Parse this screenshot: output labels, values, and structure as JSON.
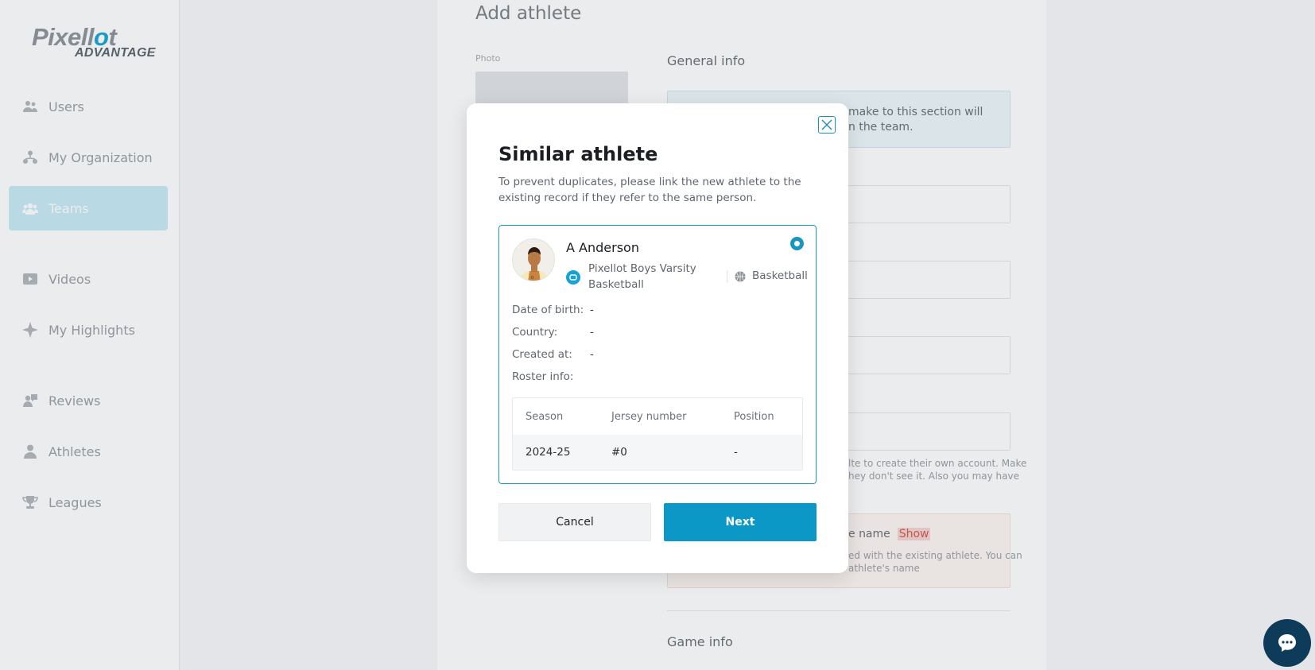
{
  "brand": {
    "logo_main_1": "Pixell",
    "logo_main_accent": "o",
    "logo_main_2": "t",
    "logo_sub": "ADVANTAGE"
  },
  "sidebar": {
    "items": [
      {
        "label": "Users",
        "icon": "users-icon"
      },
      {
        "label": "My Organization",
        "icon": "organization-icon"
      },
      {
        "label": "Teams",
        "icon": "teams-icon",
        "active": true
      },
      {
        "label": "Videos",
        "icon": "video-icon"
      },
      {
        "label": "My Highlights",
        "icon": "sparkle-icon"
      },
      {
        "label": "Reviews",
        "icon": "reviews-icon"
      },
      {
        "label": "Athletes",
        "icon": "athlete-icon"
      },
      {
        "label": "Leagues",
        "icon": "trophy-icon"
      }
    ]
  },
  "page": {
    "title": "Add athlete",
    "photo_label": "Photo",
    "general_info_title": "General info",
    "info_text_line1": "make to this section will",
    "info_text_line2": "n the team.",
    "invite_hint_line1": "lte to create their own account. Make",
    "invite_hint_line2": "hey don't see it. Also you may have",
    "same_name_label": "e name",
    "show_link": "Show",
    "warn_line1": "ed with the existing athlete. You can",
    "warn_line2": "athlete's name",
    "game_info_title": "Game info"
  },
  "modal": {
    "title": "Similar athlete",
    "description": "To prevent duplicates, please link the new athlete to the existing record if they refer to the same person.",
    "athlete": {
      "name": "A Anderson",
      "team": "Pixellot Boys Varsity Basketball",
      "sport": "Basketball",
      "fields": [
        {
          "label": "Date of birth:",
          "value": "-"
        },
        {
          "label": "Country:",
          "value": "-"
        },
        {
          "label": "Created at:",
          "value": "-"
        },
        {
          "label": "Roster info:",
          "value": ""
        }
      ],
      "roster": {
        "headers": [
          "Season",
          "Jersey number",
          "Position"
        ],
        "rows": [
          [
            "2024-25",
            "#0",
            "-"
          ]
        ]
      }
    },
    "cancel_label": "Cancel",
    "next_label": "Next"
  },
  "colors": {
    "accent": "#0b98c7",
    "active_nav": "#c8ecf7",
    "chat": "#0f3b5a"
  }
}
